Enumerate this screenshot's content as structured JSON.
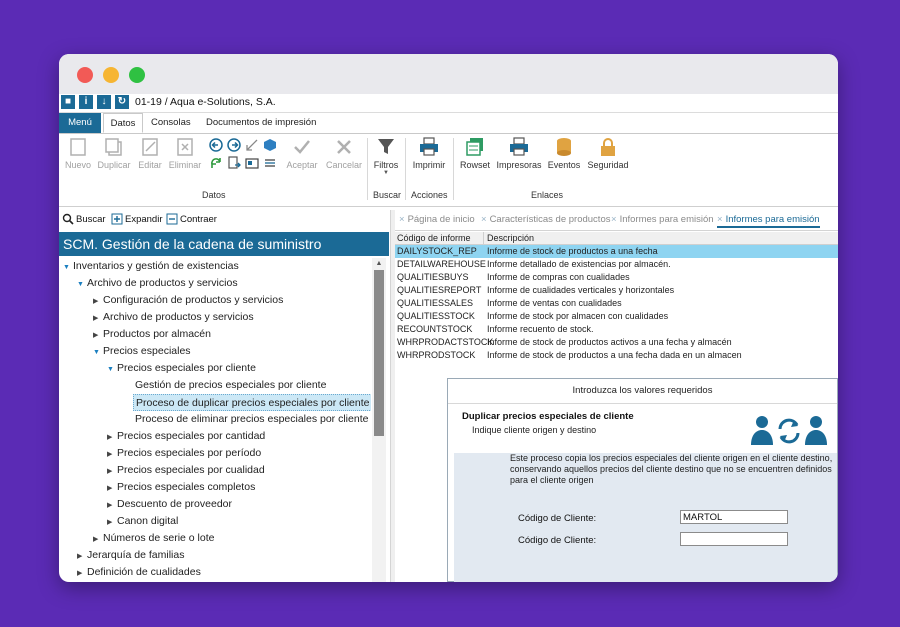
{
  "app": {
    "title": "01-19 / Aqua e-Solutions, S.A."
  },
  "ribbon_tabs": [
    "Menú",
    "Datos",
    "Consolas",
    "Documentos de impresión"
  ],
  "ribbon": {
    "datos": {
      "nuevo": "Nuevo",
      "duplicar": "Duplicar",
      "editar": "Editar",
      "eliminar": "Eliminar",
      "aceptar": "Aceptar",
      "cancelar": "Cancelar",
      "group": "Datos"
    },
    "buscar": {
      "filtros": "Filtros",
      "group": "Buscar"
    },
    "acciones": {
      "imprimir": "Imprimir",
      "group": "Acciones"
    },
    "enlaces": {
      "rowset": "Rowset",
      "impresoras": "Impresoras",
      "eventos": "Eventos",
      "seguridad": "Seguridad",
      "group": "Enlaces"
    }
  },
  "left_tools": {
    "buscar": "Buscar",
    "expandir": "Expandir",
    "contraer": "Contraer"
  },
  "tree": {
    "header": "SCM. Gestión de la cadena de suministro",
    "items": [
      "Inventarios y gestión de existencias",
      "Archivo de productos y servicios",
      "Configuración de productos y servicios",
      "Archivo de productos y servicios",
      "Productos por almacén",
      "Precios especiales",
      "Precios especiales por cliente",
      "Gestión de precios especiales por cliente",
      "Proceso de duplicar precios especiales por cliente",
      "Proceso de eliminar precios especiales por cliente",
      "Precios especiales por cantidad",
      "Precios especiales por período",
      "Precios especiales por cualidad",
      "Precios especiales completos",
      "Descuento de proveedor",
      "Canon digital",
      "Números de serie o lote",
      "Jerarquía de familias",
      "Definición de cualidades"
    ]
  },
  "doc_tabs": [
    "Página de inicio",
    "Características de productos",
    "Informes para emisión",
    "Informes para emisión"
  ],
  "grid": {
    "headers": [
      "Código de informe",
      "Descripción"
    ],
    "rows": [
      {
        "code": "DAILYSTOCK_REP",
        "desc": "Informe de stock de productos a una fecha"
      },
      {
        "code": "DETAILWAREHOUSE",
        "desc": "Informe detallado de existencias por almacén."
      },
      {
        "code": "QUALITIESBUYS",
        "desc": "Informe de compras con cualidades"
      },
      {
        "code": "QUALITIESREPORT",
        "desc": "Informe de cualidades verticales y horizontales"
      },
      {
        "code": "QUALITIESSALES",
        "desc": "Informe de ventas con cualidades"
      },
      {
        "code": "QUALITIESSTOCK",
        "desc": "Informe de stock por almacen con cualidades"
      },
      {
        "code": "RECOUNTSTOCK",
        "desc": "Informe recuento de stock."
      },
      {
        "code": "WHRPRODACTSTOCK",
        "desc": "Informe de stock de productos activos a una fecha y almacén"
      },
      {
        "code": "WHRPRODSTOCK",
        "desc": "Informe de stock de productos a una fecha dada en un almacen"
      }
    ]
  },
  "dialog": {
    "title": "Introduzca los valores requeridos",
    "heading": "Duplicar precios especiales de cliente",
    "subheading": "Indique cliente origen y destino",
    "description": "Este proceso copia los precios especiales del cliente origen en el cliente destino, conservando aquellos precios del cliente destino que no se encuentren definidos para el cliente origen",
    "field1_label": "Código de Cliente:",
    "field1_value": "MARTOL",
    "field2_label": "Código de Cliente:",
    "field2_value": ""
  },
  "colors": {
    "brand": "#1b6a96",
    "selection": "#8ed4f1",
    "background": "#5b2bb5"
  }
}
